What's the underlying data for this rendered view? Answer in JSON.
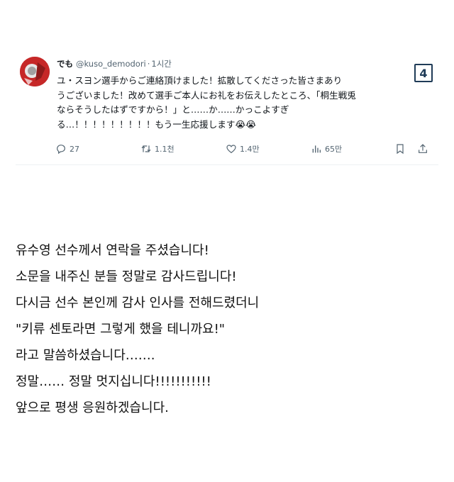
{
  "tweet": {
    "display_name": "でも",
    "handle": "@kuso_demodori",
    "time_separator": "·",
    "time": "1시간",
    "badge": "4",
    "text_lines": [
      "ユ・スヨン選手からご連絡頂けました！拡散してくださった皆さまあり",
      "うございました！改めて選手ご本人にお礼をお伝えしたところ、「桐生戦兎",
      "ならそうしたはずですから！」と……か……かっこよすぎ",
      "る…！！！！！！！！！もう一生応援します😭😭"
    ],
    "actions": {
      "replies": "27",
      "retweets": "1.1천",
      "likes": "1.4만",
      "views": "65만"
    }
  },
  "translation": {
    "lines": [
      "유수영 선수께서 연락을 주셨습니다!",
      "소문을 내주신 분들 정말로 감사드립니다!",
      "다시금 선수 본인께 감사 인사를 전해드렸더니",
      "\"키류 센토라면 그렇게 했을 테니까요!\"",
      "라고 말씀하셨습니다…….",
      "정말…… 정말 멋지십니다!!!!!!!!!!!",
      "앞으로 평생 응원하겠습니다."
    ]
  },
  "colors": {
    "text": "#0f1419",
    "muted": "#536471",
    "badge_border": "#1f3b57"
  }
}
